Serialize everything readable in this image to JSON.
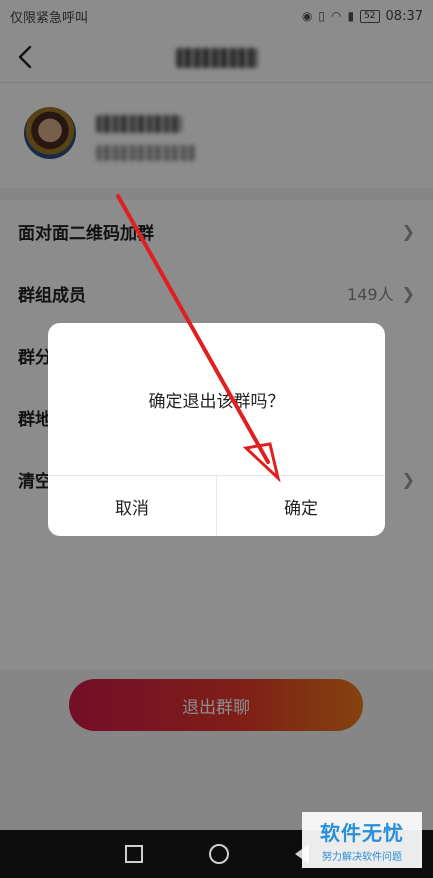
{
  "status_bar": {
    "carrier_text": "仅限紧急呼叫",
    "battery": "52",
    "time": "08:37"
  },
  "header": {
    "back_icon": "chevron-left-icon",
    "title": ""
  },
  "settings": {
    "items": [
      {
        "label": "面对面二维码加群",
        "value": ""
      },
      {
        "label": "群组成员",
        "value": "149人"
      },
      {
        "label": "群分",
        "value": ""
      },
      {
        "label": "群地",
        "value": ""
      },
      {
        "label": "清空",
        "value": ""
      }
    ]
  },
  "exit_button": {
    "label": "退出群聊"
  },
  "dialog": {
    "message": "确定退出该群吗？",
    "cancel_label": "取消",
    "confirm_label": "确定"
  },
  "watermark": {
    "main": "软件无忧",
    "sub": "努力解决软件问题"
  },
  "colors": {
    "exit_gradient_start": "#d31a4b",
    "exit_gradient_end": "#f07a1a",
    "arrow": "#e02020",
    "watermark": "#2a8fd8"
  }
}
